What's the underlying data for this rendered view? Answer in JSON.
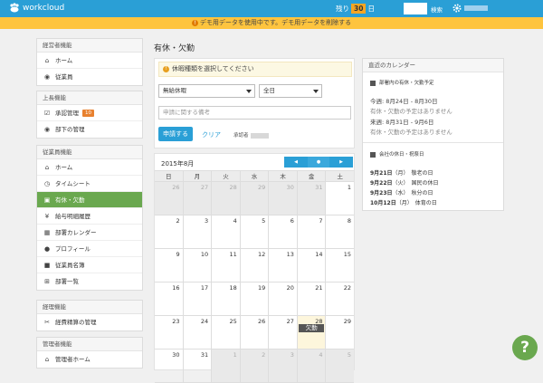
{
  "header": {
    "logo_text": "workcloud",
    "remain_prefix": "残り",
    "remain_days": "30",
    "remain_suffix": "日",
    "search_label": "検索"
  },
  "banner": {
    "text": "デモ用データを使用中です。デモ用データを削除する"
  },
  "sidebar": {
    "sections": [
      {
        "title": "経営者機能",
        "items": [
          {
            "icon": "home-icon",
            "label": "ホーム"
          },
          {
            "icon": "users-icon",
            "label": "従業員"
          }
        ]
      },
      {
        "title": "上長機能",
        "items": [
          {
            "icon": "check-icon",
            "label": "承認管理",
            "badge": "10"
          },
          {
            "icon": "users-icon",
            "label": "部下の管理"
          }
        ]
      },
      {
        "title": "従業員機能",
        "items": [
          {
            "icon": "home-icon",
            "label": "ホーム"
          },
          {
            "icon": "clock-icon",
            "label": "タイムシート"
          },
          {
            "icon": "leave-icon",
            "label": "有休・欠勤",
            "active": true
          },
          {
            "icon": "yen-icon",
            "label": "給与明細履歴"
          },
          {
            "icon": "calendar-icon",
            "label": "部署カレンダー"
          },
          {
            "icon": "user-icon",
            "label": "プロフィール"
          },
          {
            "icon": "book-icon",
            "label": "従業員名簿"
          },
          {
            "icon": "org-icon",
            "label": "部署一覧"
          }
        ]
      },
      {
        "title": "経理機能",
        "items": [
          {
            "icon": "expense-icon",
            "label": "経費精算の管理"
          }
        ]
      },
      {
        "title": "管理者機能",
        "items": [
          {
            "icon": "home-icon",
            "label": "管理者ホーム"
          }
        ]
      }
    ]
  },
  "main": {
    "title": "有休・欠勤",
    "notice": "休暇種類を選択してください",
    "leave_type": "無給休暇",
    "duration": "全日",
    "note_placeholder": "申請に関する備考",
    "apply_label": "申請する",
    "clear_label": "クリア",
    "approver_label": "承認者"
  },
  "calendar": {
    "month_label": "2015年8月",
    "prev_icon": "◀",
    "today_icon": "●",
    "next_icon": "▶",
    "weekdays": [
      "日",
      "月",
      "火",
      "水",
      "木",
      "金",
      "土"
    ],
    "weeks": [
      [
        {
          "d": "26",
          "m": true
        },
        {
          "d": "27",
          "m": true
        },
        {
          "d": "28",
          "m": true
        },
        {
          "d": "29",
          "m": true
        },
        {
          "d": "30",
          "m": true
        },
        {
          "d": "31",
          "m": true
        },
        {
          "d": "1"
        }
      ],
      [
        {
          "d": "2"
        },
        {
          "d": "3"
        },
        {
          "d": "4"
        },
        {
          "d": "5"
        },
        {
          "d": "6"
        },
        {
          "d": "7"
        },
        {
          "d": "8"
        }
      ],
      [
        {
          "d": "9"
        },
        {
          "d": "10"
        },
        {
          "d": "11"
        },
        {
          "d": "12"
        },
        {
          "d": "13"
        },
        {
          "d": "14"
        },
        {
          "d": "15"
        }
      ],
      [
        {
          "d": "16"
        },
        {
          "d": "17"
        },
        {
          "d": "18"
        },
        {
          "d": "19"
        },
        {
          "d": "20"
        },
        {
          "d": "21"
        },
        {
          "d": "22"
        }
      ],
      [
        {
          "d": "23"
        },
        {
          "d": "24"
        },
        {
          "d": "25"
        },
        {
          "d": "26"
        },
        {
          "d": "27"
        },
        {
          "d": "28",
          "today": true,
          "event": "欠勤"
        },
        {
          "d": "29"
        }
      ],
      [
        {
          "d": "30"
        },
        {
          "d": "31"
        },
        {
          "d": "1",
          "m": true
        },
        {
          "d": "2",
          "m": true
        },
        {
          "d": "3",
          "m": true
        },
        {
          "d": "4",
          "m": true
        },
        {
          "d": "5",
          "m": true
        }
      ]
    ]
  },
  "recent": {
    "title": "直近のカレンダー",
    "dept_title": "部署内の有休・欠勤予定",
    "this_week": "今週: 8月24日 - 8月30日",
    "this_week_none": "有休・欠勤の予定はありません",
    "next_week": "来週: 8月31日 - 9月6日",
    "next_week_none": "有休・欠勤の予定はありません",
    "holiday_title": "会社の休日・祝祭日",
    "holidays": [
      {
        "date": "9月21日",
        "dow": "（月）",
        "name": "敬老の日"
      },
      {
        "date": "9月22日",
        "dow": "（火）",
        "name": "国民の休日"
      },
      {
        "date": "9月23日",
        "dow": "（水）",
        "name": "秋分の日"
      },
      {
        "date": "10月12日",
        "dow": "（月）",
        "name": "体育の日"
      }
    ]
  },
  "help": {
    "label": "?"
  }
}
